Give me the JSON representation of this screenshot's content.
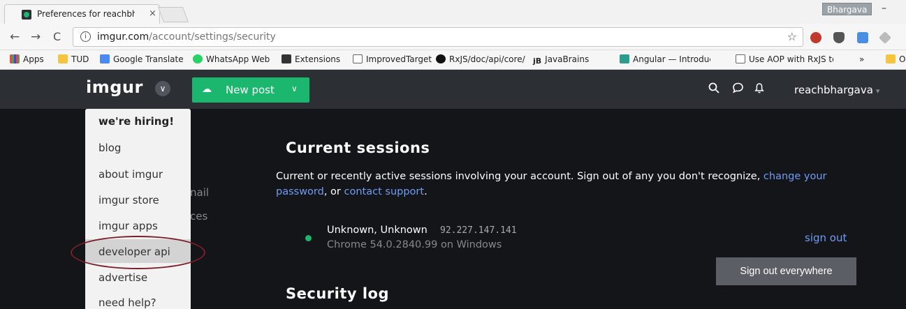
{
  "browser": {
    "tab_title": "Preferences for reachbha",
    "tab_close": "×",
    "profile_name": "Bhargava",
    "minimize_glyph": "–",
    "nav": {
      "back": "←",
      "forward": "→",
      "reload": "C"
    },
    "url_host": "imgur.com",
    "url_path": "/account/settings/security",
    "info_glyph": "i",
    "star_glyph": "☆",
    "bookmarks": [
      "Apps",
      "TUD",
      "Google Translate",
      "WhatsApp Web",
      "Extensions",
      "ImprovedTarget",
      "RxJS/doc/api/core/op",
      "JavaBrains",
      "Angular — Introductio",
      "Use AOP with RxJS to",
      "»",
      "O"
    ]
  },
  "imgur": {
    "logo": "imgur",
    "logo_chevron": "∨",
    "new_post": "New post",
    "new_post_caret": "∨",
    "username": "reachbhargava",
    "username_caret": "▾"
  },
  "menu": {
    "items": [
      "we're hiring!",
      "blog",
      "about imgur",
      "imgur store",
      "imgur apps",
      "developer api",
      "advertise",
      "need help?"
    ]
  },
  "sidebar_fragments": [
    "nail",
    "ces"
  ],
  "content": {
    "current_sessions_title": "Current sessions",
    "desc_text": "Current or recently active sessions involving your account. Sign out of any you don't recognize,",
    "desc_link1": "change your password",
    "desc_mid": ", or",
    "desc_link2": "contact support",
    "desc_end": ".",
    "session": {
      "location": "Unknown, Unknown",
      "ip": "92.227.147.141",
      "user_agent": "Chrome 54.0.2840.99 on Windows",
      "sign_out": "sign out"
    },
    "sign_out_everywhere": "Sign out everywhere",
    "security_log_title": "Security log"
  },
  "colors": {
    "imgur_green": "#1bb76e",
    "header_bg": "#2c2f34",
    "page_bg": "#141518",
    "link_blue": "#6f9cf5",
    "annotation_red": "#7c1f2a"
  }
}
